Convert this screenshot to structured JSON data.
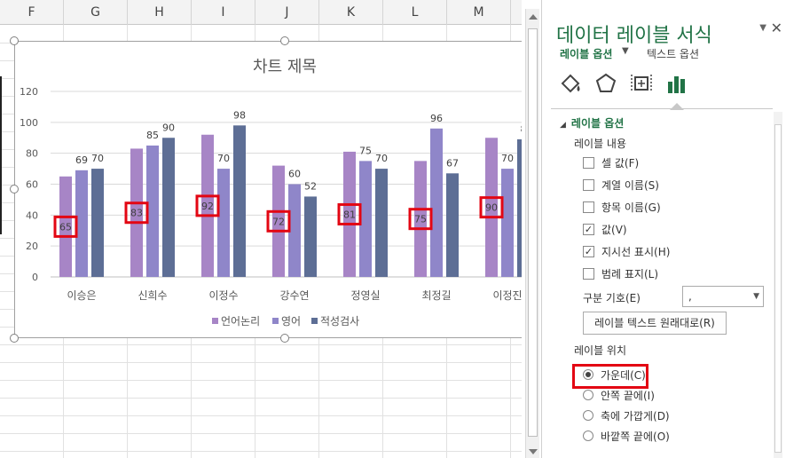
{
  "sheet": {
    "columns": [
      "F",
      "G",
      "H",
      "I",
      "J",
      "K",
      "L",
      "M"
    ]
  },
  "chart_data": {
    "type": "bar",
    "title": "차트 제목",
    "categories": [
      "이승은",
      "신희수",
      "이정수",
      "강수연",
      "정영실",
      "최정길",
      "이정진"
    ],
    "series": [
      {
        "name": "언어논리",
        "color": "#a785c6",
        "values": [
          65,
          83,
          92,
          72,
          81,
          75,
          90
        ]
      },
      {
        "name": "영어",
        "color": "#8f86c9",
        "values": [
          69,
          85,
          70,
          60,
          75,
          96,
          70
        ]
      },
      {
        "name": "적성검사",
        "color": "#5d6e95",
        "values": [
          70,
          90,
          98,
          52,
          70,
          67,
          89
        ]
      }
    ],
    "ylim": [
      0,
      120
    ],
    "yticks": [
      0,
      20,
      40,
      60,
      80,
      100,
      120
    ],
    "gridlines": true,
    "legend_position": "bottom",
    "label_highlight_color": "#e30613",
    "visible_labels": [
      [
        "65",
        "69",
        "70"
      ],
      [
        "83",
        "85",
        "90"
      ],
      [
        "92",
        "70",
        "98"
      ],
      [
        "72",
        "60",
        "52"
      ],
      [
        "81",
        "75",
        "70"
      ],
      [
        "75",
        "96",
        "67"
      ],
      [
        "90",
        "70",
        "8"
      ]
    ],
    "visible_categories": [
      "이승은",
      "신희수",
      "이정수",
      "강수연",
      "정영실",
      "최정길",
      "이정진"
    ]
  },
  "panel": {
    "title": "데이터 레이블 서식",
    "tab_label_options": "레이블 옵션",
    "tab_text_options": "텍스트 옵션",
    "section_header": "레이블 옵션",
    "label_contains_header": "레이블 내용",
    "checkboxes": [
      {
        "label": "셀 값(F)",
        "checked": false
      },
      {
        "label": "계열 이름(S)",
        "checked": false
      },
      {
        "label": "항목 이름(G)",
        "checked": false
      },
      {
        "label": "값(V)",
        "checked": true
      },
      {
        "label": "지시선 표시(H)",
        "checked": true
      },
      {
        "label": "범례 표지(L)",
        "checked": false
      }
    ],
    "separator_label": "구분 기호(E)",
    "separator_value": ",",
    "reset_button": "레이블 텍스트 원래대로(R)",
    "label_position_header": "레이블 위치",
    "radios": [
      {
        "label": "가운데(C)",
        "selected": true
      },
      {
        "label": "안쪽 끝에(I)",
        "selected": false
      },
      {
        "label": "축에 가깝게(D)",
        "selected": false
      },
      {
        "label": "바깥쪽 끝에(O)",
        "selected": false
      }
    ],
    "accent_color": "#217346"
  }
}
